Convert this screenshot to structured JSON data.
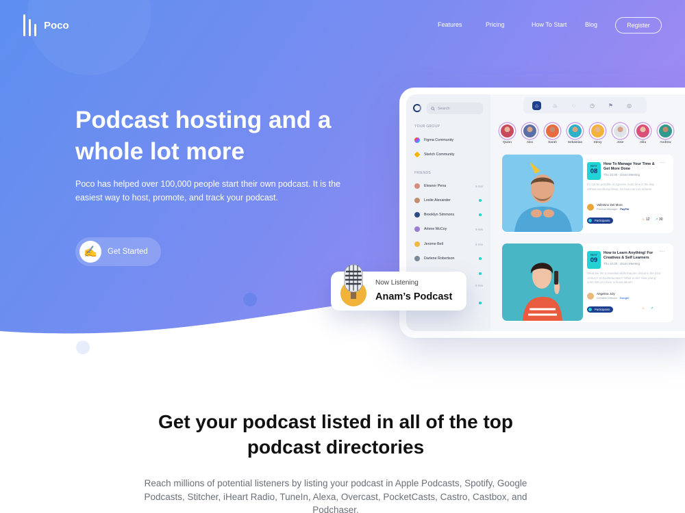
{
  "brand": {
    "name": "Poco"
  },
  "nav": {
    "links": [
      "Features",
      "Pricing",
      "How To Start",
      "Blog"
    ],
    "register": "Register"
  },
  "hero": {
    "title": "Podcast hosting and a whole lot more",
    "description": "Poco has helped over 100,000 people start their own podcast. It is the easiest way to host, promote, and track your podcast.",
    "cta": "Get Started",
    "cta_icon": "writing-hand-icon"
  },
  "dashboard": {
    "search_placeholder": "Search",
    "your_group_label": "YOUR GROUP",
    "groups": [
      "Figma Community",
      "Sketch Community"
    ],
    "friends_label": "FRIENDS",
    "friends": [
      {
        "name": "Eleanor Pena",
        "time": "9 min"
      },
      {
        "name": "Leslie Alexander",
        "online": true
      },
      {
        "name": "Brooklyn Simmons",
        "online": true
      },
      {
        "name": "Arlene McCoy",
        "time": "9 min"
      },
      {
        "name": "Jerome Bell",
        "time": "9 min"
      },
      {
        "name": "Darlene Robertson",
        "online": true
      }
    ],
    "extra_rows": [
      {
        "online": true
      },
      {
        "time": "9 min"
      },
      {
        "online": true
      }
    ],
    "toolbar_icons": [
      "home-icon",
      "fire-icon",
      "chat-icon",
      "clock-icon",
      "flag-icon",
      "settings-icon"
    ],
    "people": [
      "Quinn",
      "Alex",
      "Sarah",
      "Sebastian",
      "Stevy",
      "Jose",
      "Alila",
      "Andrew"
    ],
    "events": [
      {
        "month": "MAY",
        "day": "08",
        "title": "How To Manage Your Time & Get More Done",
        "time": "Thu 10.00 - Zoom Meeting",
        "text": "It's not be possible to squeeze more time in the day without sacrificing sleep. So how can you achieve",
        "host": "Valentino Del More",
        "role": "Product Manager",
        "company": "PayPal",
        "participants": "Participants",
        "likes": "12",
        "shares": "30"
      },
      {
        "month": "MAY",
        "day": "09",
        "title": "How to Learn Anything! For Creatives & Self Learners",
        "time": "Thu 10.00 - Zoom Meeting",
        "text": "What are the 3 essential skills that are critical in the 21st century? School/education? What to do? How young ones that you have to know about?",
        "host": "Angelina Joly",
        "role": "Creative Director",
        "company": "Google",
        "participants": "Participants",
        "likes": "",
        "shares": ""
      }
    ]
  },
  "now_listening": {
    "label": "Now Listening",
    "title": "Anam’s Podcast",
    "icon": "microphone-icon"
  },
  "directories": {
    "title": "Get your podcast listed in all of the top podcast directories",
    "description": "Reach millions of potential listeners by listing your podcast in Apple Podcasts, Spotify, Google Podcasts, Stitcher, iHeart Radio, TuneIn, Alexa, Overcast, PocketCasts, Castro, Castbox, and Podchaser."
  },
  "colors": {
    "gradient_left": "#5c8ff0",
    "gradient_right": "#9b86f2",
    "accent_teal": "#23d3d3",
    "accent_navy": "#1d3f8f"
  }
}
